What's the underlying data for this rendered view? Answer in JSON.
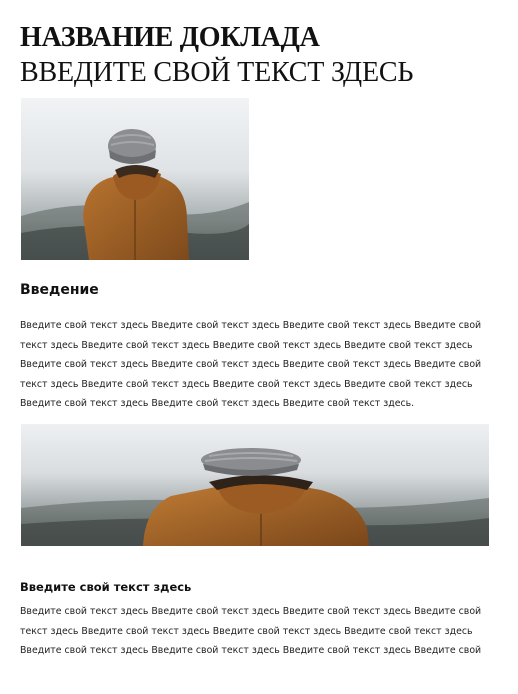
{
  "document": {
    "title": "НАЗВАНИЕ ДОКЛАДА",
    "subtitle": "ВВЕДИТЕ СВОЙ ТЕКСТ ЗДЕСЬ",
    "sections": [
      {
        "heading": "Введение",
        "body": "Введите свой текст здесь Введите свой текст здесь Введите свой текст здесь Введите свой текст здесь Введите свой текст здесь Введите свой текст здесь Введите свой текст здесь Введите свой текст здесь Введите свой текст здесь Введите свой текст здесь Введите свой текст здесь Введите свой текст здесь Введите свой текст здесь Введите свой текст здесь Введите свой текст здесь Введите свой текст здесь Введите свой текст здесь."
      },
      {
        "heading": "Введите свой текст здесь",
        "body": "Введите свой текст здесь Введите свой текст здесь Введите свой текст здесь Введите свой текст здесь Введите свой текст здесь Введите свой текст здесь Введите свой текст здесь Введите свой текст здесь Введите свой текст здесь Введите свой текст здесь Введите свой текст"
      }
    ]
  },
  "colors": {
    "text": "#111111",
    "jacket": "#a8652a",
    "hat": "#8a8a8c",
    "fog": "#e9ecef",
    "forest": "#4a524f"
  },
  "images": [
    {
      "icon": "person-in-fog-photo"
    },
    {
      "icon": "person-in-fog-photo"
    }
  ]
}
